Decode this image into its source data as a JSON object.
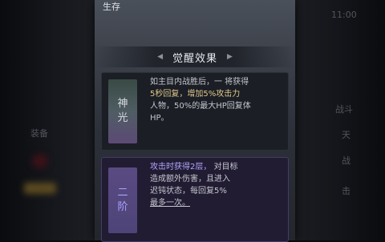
{
  "panel": {
    "top_label": "生存",
    "section_title": "觉醒效果"
  },
  "cards": [
    {
      "tag": "神\n光",
      "text_segments": [
        "如主目内战胜后，一 将获得",
        "5秒回复，增加5%攻击力",
        "人物，50%的最大HP回复体",
        "HP。"
      ]
    },
    {
      "tag": "二\n阶",
      "text_segments": [
        "攻击时获得2层，",
        "对目标",
        "造成额外伤害，且进入",
        "迟钝状态，每回复5%",
        "最多一次。"
      ]
    }
  ],
  "side_right": {
    "top": "11:00",
    "items": [
      "战斗",
      "天",
      "战",
      "击"
    ]
  },
  "side_left": {
    "label": "装备"
  },
  "colors": {
    "panel": "#3e434c",
    "card1_bg": "#1b1e25",
    "card2_bg": "#221c33",
    "highlight": "#e0c88a"
  }
}
